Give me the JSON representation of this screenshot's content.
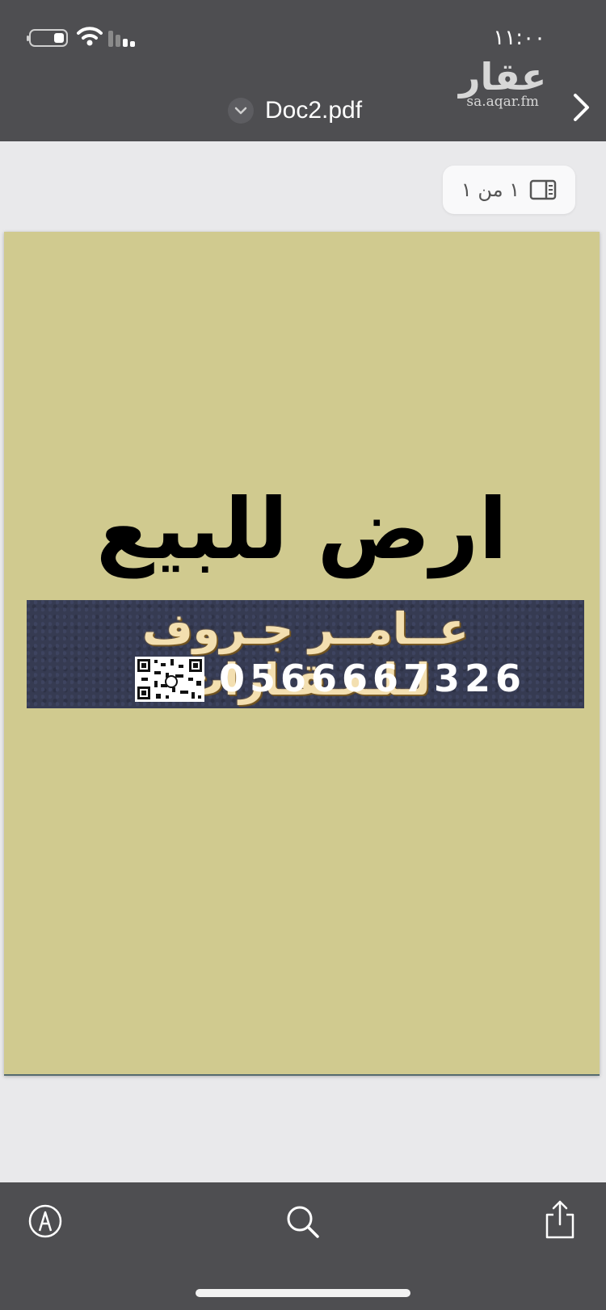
{
  "status_bar": {
    "time": "١١:٠٠"
  },
  "watermark": {
    "arabic": "عقار",
    "domain": "sa.aqar.fm"
  },
  "header": {
    "title": "Doc2.pdf"
  },
  "page_indicator": {
    "text": "١ من ١"
  },
  "document": {
    "heading": "ارض للبيع",
    "banner_name": "عــامــر جـروف لـلـعـقـارات",
    "banner_phone": "0566667326",
    "background_color": "#d0ca8f",
    "banner_color": "#363b52"
  },
  "toolbar": {
    "icons": [
      "markup-pen-icon",
      "search-icon",
      "share-icon"
    ]
  }
}
